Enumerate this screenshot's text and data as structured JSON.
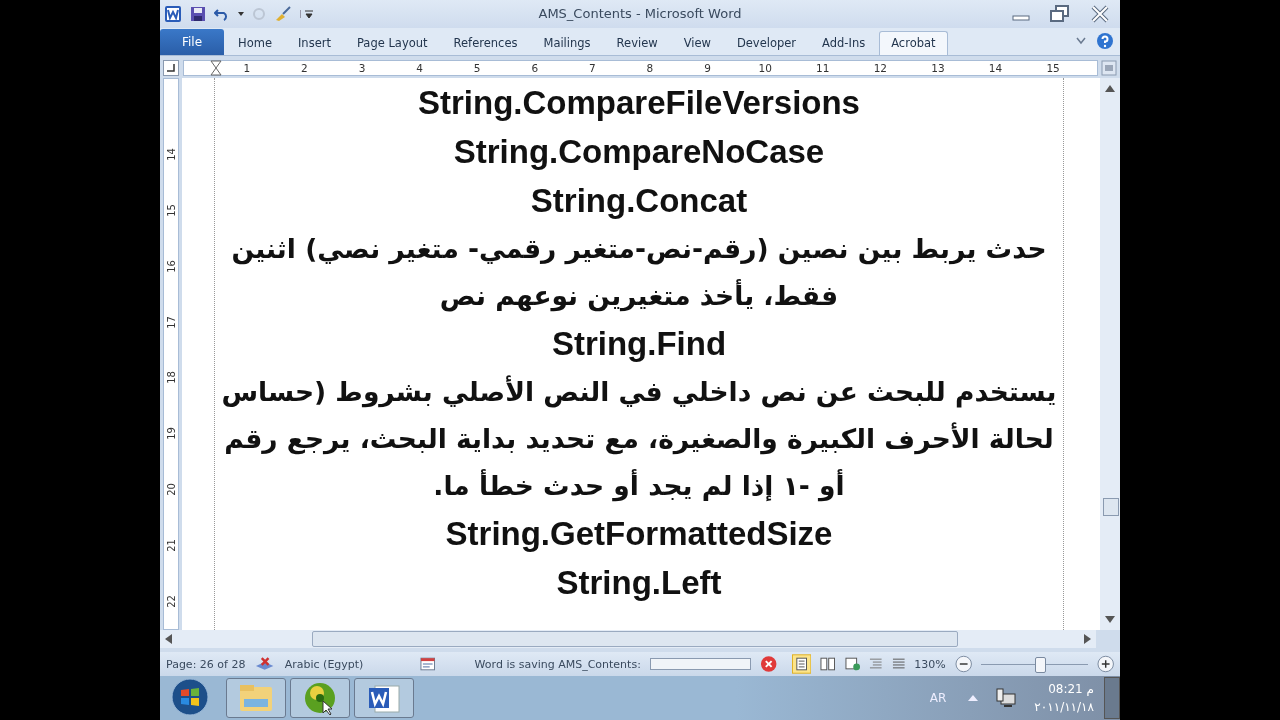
{
  "window": {
    "title": "AMS_Contents - Microsoft Word"
  },
  "ribbon": {
    "tabs": [
      {
        "label": "File",
        "kind": "file",
        "selected": false
      },
      {
        "label": "Home",
        "kind": "tab",
        "selected": false
      },
      {
        "label": "Insert",
        "kind": "tab",
        "selected": false
      },
      {
        "label": "Page Layout",
        "kind": "tab",
        "selected": false
      },
      {
        "label": "References",
        "kind": "tab",
        "selected": false
      },
      {
        "label": "Mailings",
        "kind": "tab",
        "selected": false
      },
      {
        "label": "Review",
        "kind": "tab",
        "selected": false
      },
      {
        "label": "View",
        "kind": "tab",
        "selected": false
      },
      {
        "label": "Developer",
        "kind": "tab",
        "selected": false
      },
      {
        "label": "Add-Ins",
        "kind": "tab",
        "selected": false
      },
      {
        "label": "Acrobat",
        "kind": "tab",
        "selected": true
      }
    ]
  },
  "ruler": {
    "numbers": [
      "1",
      "2",
      "3",
      "4",
      "5",
      "6",
      "7",
      "8",
      "9",
      "10",
      "11",
      "12",
      "13",
      "14",
      "15"
    ]
  },
  "vertical_ruler": {
    "numbers": [
      "14",
      "15",
      "16",
      "17",
      "18",
      "19",
      "20",
      "21",
      "22"
    ]
  },
  "document": {
    "paragraphs": [
      {
        "kind": "heading",
        "text": "String.CompareFileVersions"
      },
      {
        "kind": "heading",
        "text": "String.CompareNoCase"
      },
      {
        "kind": "heading",
        "text": "String.Concat"
      },
      {
        "kind": "body",
        "text": "حدث يربط بين نصين (رقم-نص-متغير رقمي- متغير نصي) اثنين فقط، يأخذ متغيرين نوعهم نص"
      },
      {
        "kind": "heading",
        "text": "String.Find"
      },
      {
        "kind": "body",
        "text": "يستخدم للبحث عن نص داخلي في النص الأصلي بشروط (حساس لحالة الأحرف الكبيرة والصغيرة، مع تحديد بداية البحث، يرجع رقم أو -١ إذا لم يجد أو حدث خطأ ما."
      },
      {
        "kind": "heading",
        "text": "String.GetFormattedSize"
      },
      {
        "kind": "heading",
        "text": "String.Left"
      }
    ]
  },
  "status_bar": {
    "page": "Page: 26 of 28",
    "language": "Arabic (Egypt)",
    "saving": "Word is saving AMS_Contents:",
    "zoom": "130%",
    "zoom_slider": {
      "level": 0.55
    }
  },
  "taskbar": {
    "language": "AR",
    "time": "08:21 م",
    "date": "٢٠١١/١١/١٨"
  }
}
